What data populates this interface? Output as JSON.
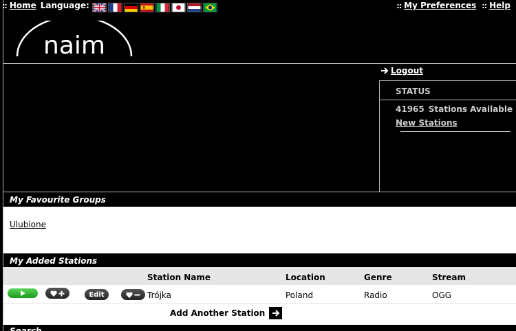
{
  "topbar": {
    "home_label": "Home",
    "language_label": "Language:",
    "preferences_label": "My Preferences",
    "help_label": "Help",
    "separator": "::",
    "flags": [
      "flag-uk-icon",
      "flag-france-icon",
      "flag-germany-icon",
      "flag-spain-icon",
      "flag-italy-icon",
      "flag-japan-icon",
      "flag-netherlands-icon",
      "flag-brazil-icon"
    ]
  },
  "logo": {
    "text": "naim"
  },
  "account": {
    "logout_label": "Logout"
  },
  "status": {
    "title": "STATUS",
    "count": "41965",
    "count_label": "Stations Available",
    "new_stations_label": "New Stations"
  },
  "favourites": {
    "header": "My Favourite Groups",
    "groups": [
      "Ulubione"
    ]
  },
  "added": {
    "header": "My Added Stations",
    "columns": [
      "Station Name",
      "Location",
      "Genre",
      "Stream"
    ],
    "rows": [
      {
        "name": "Trójka",
        "location": "Poland",
        "genre": "Radio",
        "stream": "OGG",
        "edit_label": "Edit"
      }
    ],
    "add_another_label": "Add Another Station"
  },
  "search": {
    "header": "Search"
  },
  "colors": {
    "background": "#000000",
    "play_green": "#2db82d",
    "table_header": "#e6e6e6"
  }
}
